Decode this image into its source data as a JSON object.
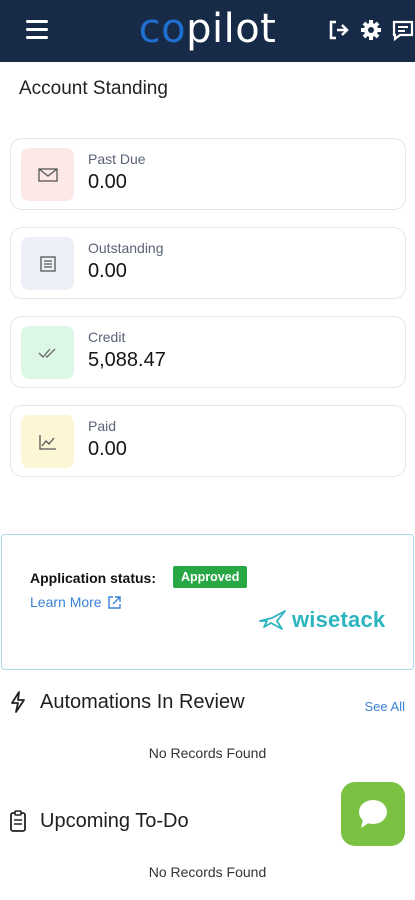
{
  "header": {
    "logo_part1": "co",
    "logo_part2": "pilot",
    "background": "#172a47",
    "icons": [
      "menu-icon",
      "logout-icon",
      "gear-icon",
      "message-icon"
    ]
  },
  "account_standing": {
    "title": "Account Standing",
    "cards": [
      {
        "label": "Past Due",
        "value": "0.00",
        "icon": "envelope-icon",
        "color": "#fde8e8"
      },
      {
        "label": "Outstanding",
        "value": "0.00",
        "icon": "document-icon",
        "color": "#eceff5"
      },
      {
        "label": "Credit",
        "value": "5,088.47",
        "icon": "double-check-icon",
        "color": "#dcf7e6"
      },
      {
        "label": "Paid",
        "value": "0.00",
        "icon": "chart-line-icon",
        "color": "#fdf6d5"
      }
    ]
  },
  "application": {
    "status_label": "Application status:",
    "status_badge": "Approved",
    "learn_more": "Learn More",
    "brand": "wisetack"
  },
  "automations": {
    "title": "Automations In Review",
    "see_all": "See All",
    "empty": "No Records Found"
  },
  "todo": {
    "title": "Upcoming To-Do",
    "empty": "No Records Found"
  },
  "colors": {
    "accent": "#3a82d6",
    "approved": "#28a745",
    "chat_fab": "#7cc242",
    "brand_teal": "#2cb5be"
  }
}
